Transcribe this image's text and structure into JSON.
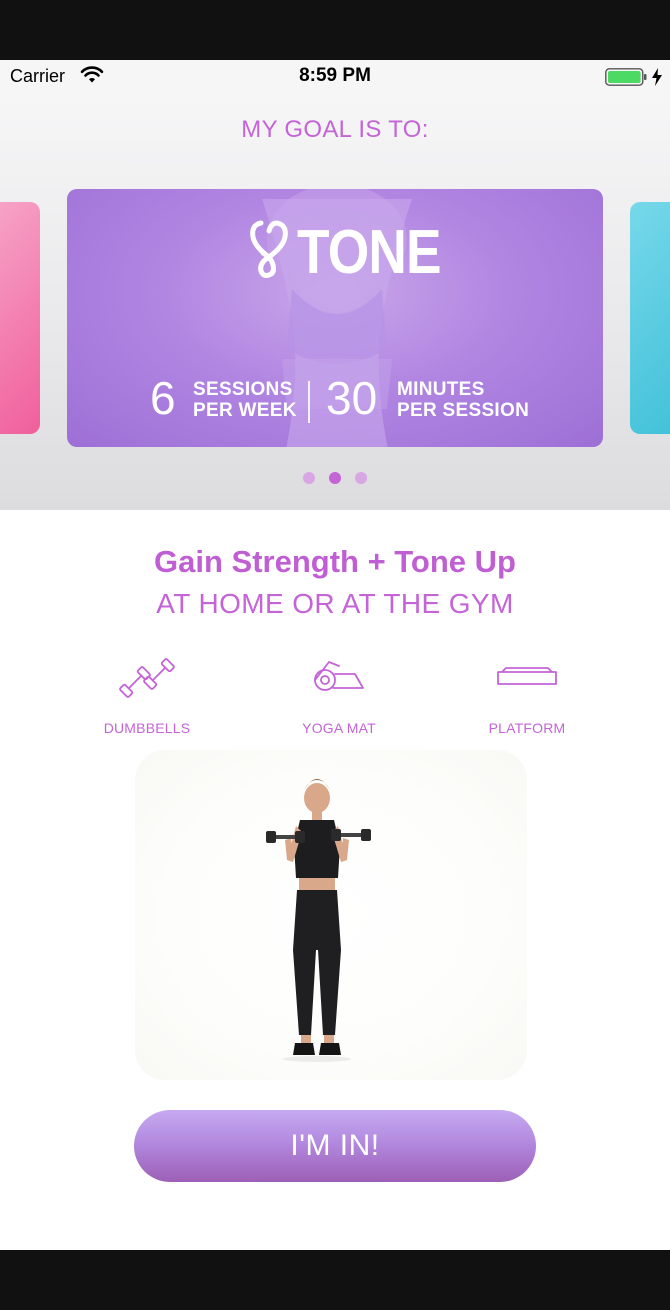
{
  "status_bar": {
    "carrier": "Carrier",
    "time": "8:59 PM",
    "battery_color": "#4cd964"
  },
  "goal": {
    "title": "MY GOAL IS TO:",
    "carousel": {
      "card": {
        "title": "TONE",
        "logo_icon": "heart-ribbon-icon",
        "sessions_value": "6",
        "sessions_label_line1": "SESSIONS",
        "sessions_label_line2": "PER WEEK",
        "minutes_value": "30",
        "minutes_label_line1": "MINUTES",
        "minutes_label_line2": "PER SESSION"
      },
      "pages": 3,
      "active_page": 2,
      "left_card_color": "#f05f9c",
      "right_card_color": "#3fc0d8"
    }
  },
  "program": {
    "headline": "Gain Strength + Tone Up",
    "subheadline": "AT HOME OR AT THE GYM"
  },
  "equipment": [
    {
      "icon": "dumbbells-icon",
      "label": "DUMBBELLS"
    },
    {
      "icon": "yoga-mat-icon",
      "label": "YOGA MAT"
    },
    {
      "icon": "platform-icon",
      "label": "PLATFORM"
    }
  ],
  "cta": {
    "label": "I'M IN!"
  },
  "colors": {
    "accent": "#c464d6",
    "card_purple": "#b186e2"
  }
}
